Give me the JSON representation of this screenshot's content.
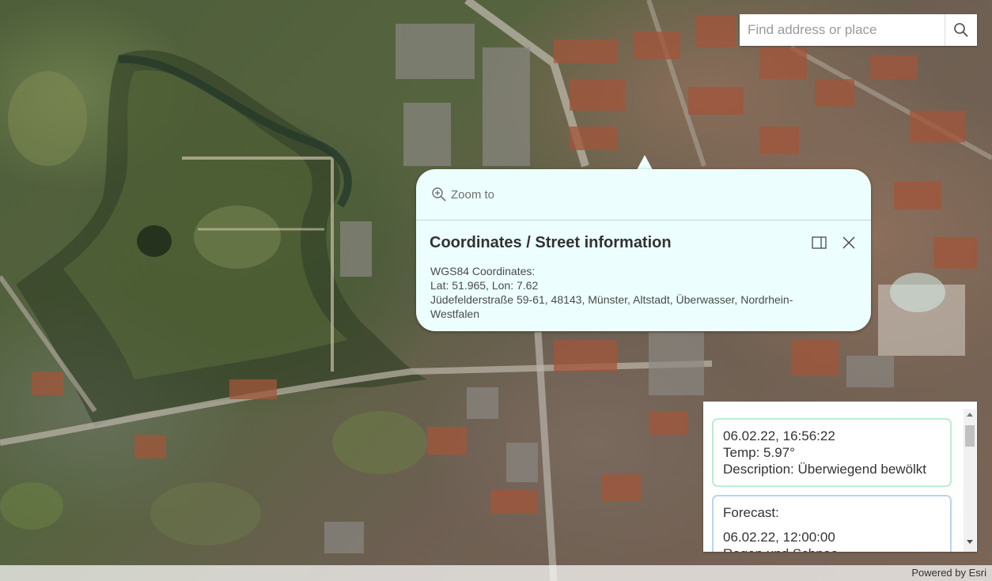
{
  "search": {
    "placeholder": "Find address or place",
    "icon": "search-icon"
  },
  "popup": {
    "action_label": "Zoom to",
    "action_icon": "zoom-in-icon",
    "title": "Coordinates / Street information",
    "dock_icon": "dock-icon",
    "close_icon": "close-icon",
    "lines": [
      "WGS84 Coordinates:",
      "Lat: 51.965, Lon: 7.62",
      "Jüdefelderstraße 59-61, 48143, Münster, Altstadt, Überwasser, Nordrhein-Westfalen"
    ],
    "background_color": "#ecfffe"
  },
  "weather": {
    "current": {
      "datetime": "06.02.22, 16:56:22",
      "temp": "Temp: 5.97°",
      "description": "Description: Überwiegend bewölkt",
      "border_color": "#b9efcf"
    },
    "forecast": {
      "heading": "Forecast:",
      "datetime": "06.02.22, 12:00:00",
      "partial_line": "Regen und Schnee",
      "border_color": "#b9d4f1"
    }
  },
  "attribution": "Powered by Esri"
}
